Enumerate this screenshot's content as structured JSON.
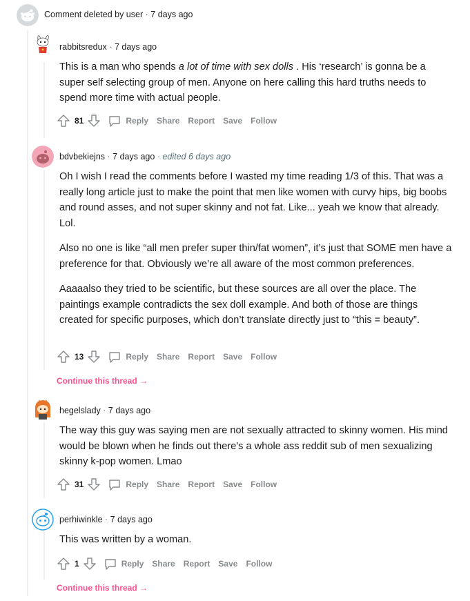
{
  "deleted": {
    "text": "Comment deleted by user",
    "sep": "·",
    "time": "7 days ago"
  },
  "comments": [
    {
      "author": "rabbitsredux",
      "sep": "·",
      "time": "7 days ago",
      "body_pre": "This is a man who spends ",
      "body_em": "a lot of time with sex dolls",
      "body_post": " . His ‘research’ is gonna be a super self selecting group of men. Anyone on here calling this hard truths needs to spend more time with actual people.",
      "votes": "81",
      "actions": {
        "reply": "Reply",
        "share": "Share",
        "report": "Report",
        "save": "Save",
        "follow": "Follow"
      }
    },
    {
      "author": "bdvbekiejns",
      "sep": "·",
      "time": "7 days ago",
      "sep2": "·",
      "edited": "edited 6 days ago",
      "paragraphs": [
        "Oh I wish I read the comments before I wasted my time reading 1/3 of this. That was a really long article just to make the point that men like women with curvy hips, big boobs and round asses, and not super skinny and not fat. Like... yeah we know that already. Lol.",
        "Also no one is like “all men prefer super thin/fat women”, it’s just that SOME men have a preference for that. Obviously we’re all aware of the most common preferences.",
        "Aaaaalso they tried to be scientific, but these sources are all over the place. The paintings example contradicts the sex doll example. And both of those are things created for specific purposes, which don’t translate directly just to “this = beauty”."
      ],
      "votes": "13",
      "actions": {
        "reply": "Reply",
        "share": "Share",
        "report": "Report",
        "save": "Save",
        "follow": "Follow"
      }
    },
    {
      "author": "hegelslady",
      "sep": "·",
      "time": "7 days ago",
      "body": "The way this guy was saying men are not sexually attracted to skinny women. His mind would be blown when he finds out there's a whole ass reddit sub of men sexualizing skinny k-pop women. Lmao",
      "votes": "31",
      "actions": {
        "reply": "Reply",
        "share": "Share",
        "report": "Report",
        "save": "Save",
        "follow": "Follow"
      }
    },
    {
      "author": "perhiwinkle",
      "sep": "·",
      "time": "7 days ago",
      "body": "This was written by a woman.",
      "votes": "1",
      "actions": {
        "reply": "Reply",
        "share": "Share",
        "report": "Report",
        "save": "Save",
        "follow": "Follow"
      }
    }
  ],
  "continue_thread": "Continue this thread",
  "continue_arrow": "→",
  "colors": {
    "accent_link": "#ff4f8f",
    "meta": "#576f76",
    "action": "#878a8c",
    "rail": "#edeff1"
  }
}
